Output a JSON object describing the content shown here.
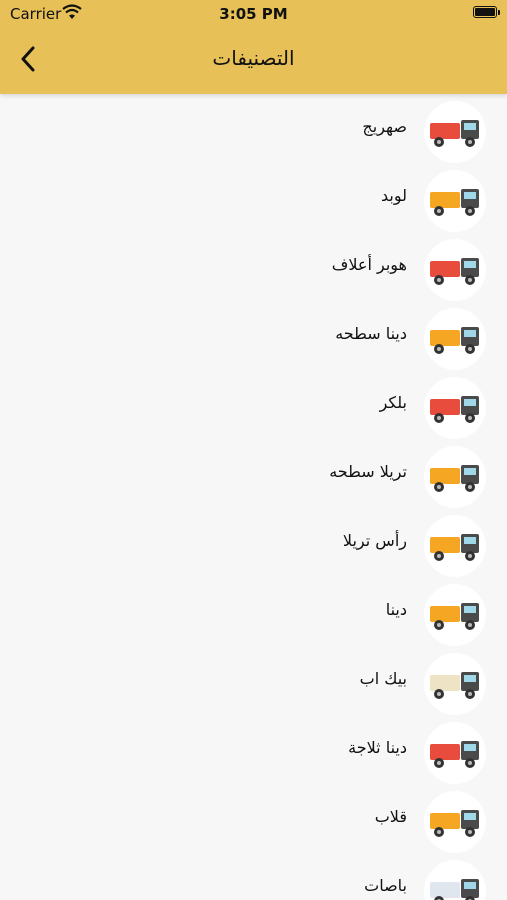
{
  "status_bar": {
    "carrier": "Carrier",
    "time": "3:05 PM"
  },
  "nav": {
    "title": "التصنيفات",
    "back_icon": "chevron-left-icon"
  },
  "categories": [
    {
      "label": "صهريج",
      "icon": "tanker-truck-icon",
      "color": "#e74c3c"
    },
    {
      "label": "لوبد",
      "icon": "lowbed-truck-icon",
      "color": "#f5a623"
    },
    {
      "label": "هوبر أعلاف",
      "icon": "feed-hopper-truck-icon",
      "color": "#e74c3c"
    },
    {
      "label": "دينا سطحه",
      "icon": "flatbed-dyna-truck-icon",
      "color": "#f5a623"
    },
    {
      "label": "بلكر",
      "icon": "bulker-truck-icon",
      "color": "#e74c3c"
    },
    {
      "label": "تريلا سطحه",
      "icon": "flatbed-trailer-icon",
      "color": "#f5a623"
    },
    {
      "label": "رأس تريلا",
      "icon": "trailer-head-icon",
      "color": "#f5a623"
    },
    {
      "label": "دينا",
      "icon": "dyna-truck-icon",
      "color": "#f5a623"
    },
    {
      "label": "بيك اب",
      "icon": "pickup-truck-icon",
      "color": "#efe3c6"
    },
    {
      "label": "دينا ثلاجة",
      "icon": "refrigerated-truck-icon",
      "color": "#e74c3c"
    },
    {
      "label": "قلاب",
      "icon": "dump-truck-icon",
      "color": "#f5a623"
    },
    {
      "label": "باصات",
      "icon": "bus-icon",
      "color": "#dfe6ee"
    }
  ]
}
